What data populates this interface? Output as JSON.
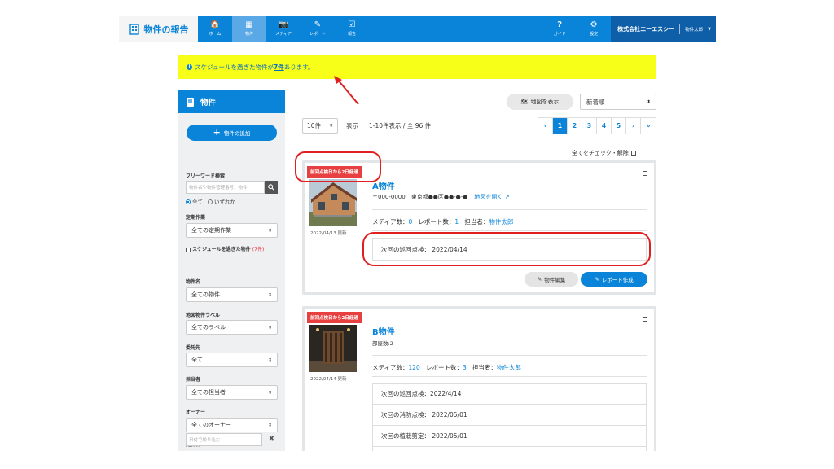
{
  "header": {
    "app_title": "物件の報告",
    "nav": [
      {
        "label": "ホーム",
        "icon": "home-icon",
        "glyph": "🏠"
      },
      {
        "label": "物件",
        "icon": "building-icon",
        "glyph": "▦"
      },
      {
        "label": "メディア",
        "icon": "camera-icon",
        "glyph": "📷"
      },
      {
        "label": "レポート",
        "icon": "pen-icon",
        "glyph": "✎"
      },
      {
        "label": "報告",
        "icon": "clipboard-check-icon",
        "glyph": "☑"
      }
    ],
    "help": {
      "label": "ガイド",
      "glyph": "?"
    },
    "settings": {
      "label": "設定",
      "glyph": "⚙"
    },
    "company": "株式会社エーエスシー",
    "user": "物件太郎"
  },
  "alert": {
    "prefix": "スケジュールを過ぎた物件が",
    "count": "7件",
    "suffix": "あります。"
  },
  "sidebar": {
    "title": "物件",
    "add_button": "物件の追加",
    "freeword_label": "フリーワード検索",
    "freeword_placeholder": "物件名や物件管理番号、物件",
    "radio_all": "全て",
    "radio_any": "いずれか",
    "periodic_label": "定期作業",
    "periodic_value": "全ての定期作業",
    "overdue_label": "スケジュールを過ぎた物件",
    "overdue_count": "(7件)",
    "property_label": "物件名",
    "property_value": "全ての物件",
    "maplabel_label": "地図物件ラベル",
    "maplabel_value": "全てのラベル",
    "consign_label": "委託先",
    "consign_value": "全て",
    "staff_label": "担当者",
    "staff_value": "全ての担当者",
    "owner_label": "オーナー",
    "owner_value": "全てのオーナー",
    "updated_label": "更新日",
    "date_placeholder": "日付で絞り込む"
  },
  "toolbar": {
    "map_button": "地図を表示",
    "sort_value": "新着順",
    "per_page": "10件",
    "per_page_label": "表示",
    "range": "1-10件表示 / 全 96 件",
    "pages": [
      "‹",
      "1",
      "2",
      "3",
      "4",
      "5",
      "›",
      "»"
    ],
    "current_page": "1",
    "check_all": "全てをチェック・解除"
  },
  "cards": [
    {
      "tag": "前回点検日から2日経過",
      "name": "A物件",
      "address": "〒000-0000　東京都●●区●●-●-●",
      "map_link": "地図を開く",
      "updated": "2022/04/13 更新",
      "media_label": "メディア数：",
      "media_count": "0",
      "report_label": "レポート数：",
      "report_count": "1",
      "staff_label": "担当者：",
      "staff": "物件太郎",
      "schedules": [
        "次回の巡回点検： 2022/04/14"
      ],
      "edit_button": "物件編集",
      "report_button": "レポート作成"
    },
    {
      "tag": "前回点検日から2日経過",
      "name": "B物件",
      "sub": "部屋数:2",
      "updated": "2022/04/14 更新",
      "media_label": "メディア数：",
      "media_count": "120",
      "report_label": "レポート数：",
      "report_count": "3",
      "staff_label": "担当者：",
      "staff": "物件太郎",
      "schedules": [
        "次回の巡回点検：2022/4/14",
        "次回の消防点検： 2022/05/01",
        "次回の植栽剪定： 2022/05/01",
        ""
      ]
    }
  ],
  "colors": {
    "accent": "#0a84d8",
    "alert_bg": "#f7ff18",
    "tag": "#e84040",
    "annotation": "#e02020"
  }
}
